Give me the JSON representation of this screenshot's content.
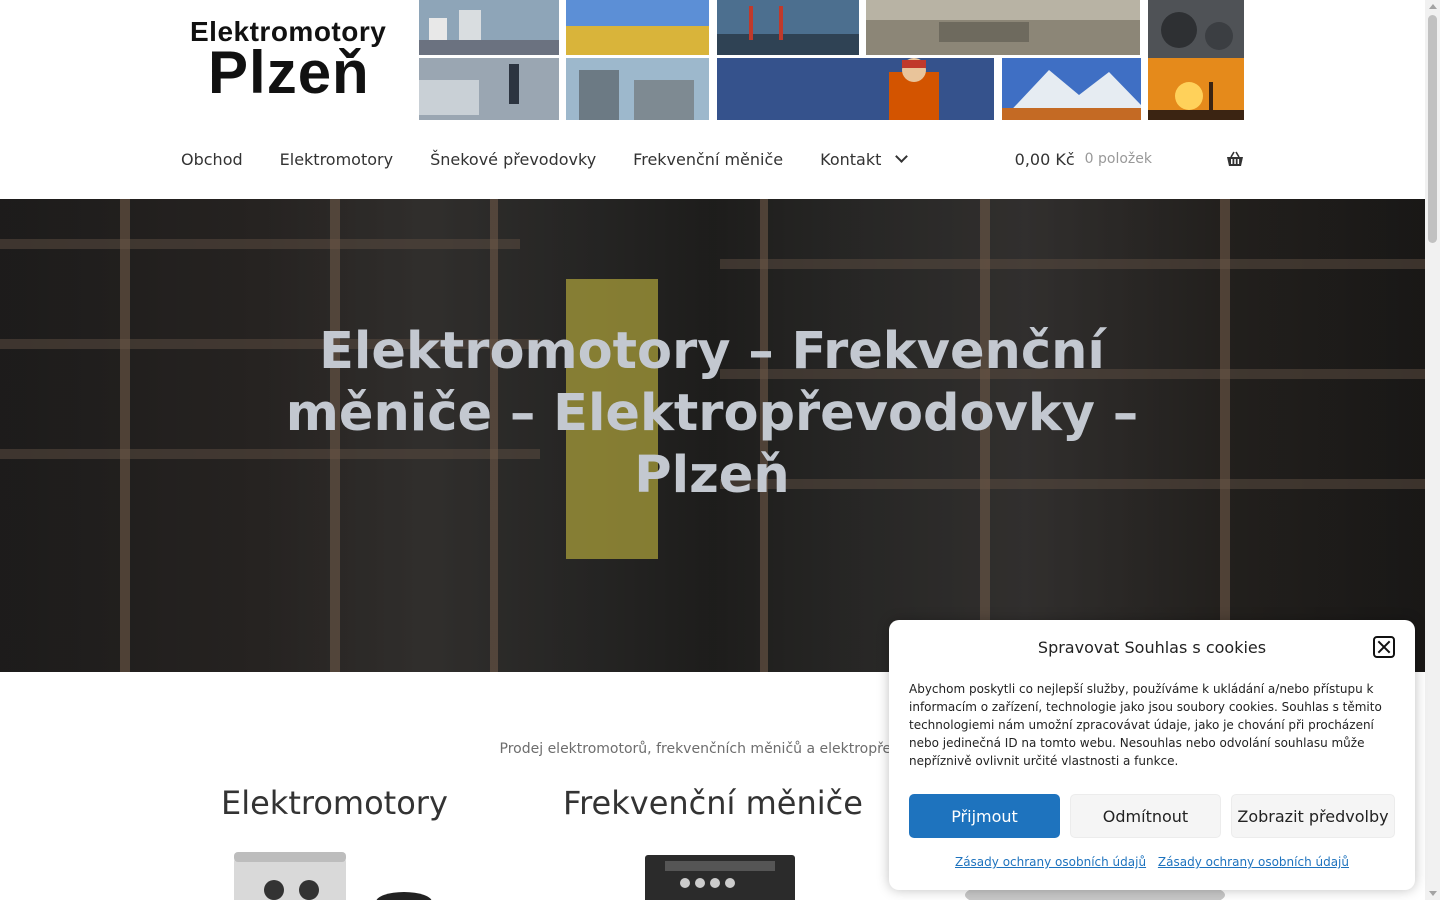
{
  "logo": {
    "line1": "Elektromotory",
    "line2": "Plzeň"
  },
  "nav": {
    "items": [
      "Obchod",
      "Elektromotory",
      "Šnekové převodovky",
      "Frekvenční měniče",
      "Kontakt"
    ]
  },
  "cart": {
    "amount": "0,00 Kč",
    "count": "0 položek",
    "icon": "basket-icon"
  },
  "hero": {
    "title": "Elektromotory – Frekvenční měniče – Elektropřevodovky – Plzeň"
  },
  "content": {
    "tagline": "Prodej elektromotorů, frekvenčních měničů a elektropřevodo",
    "categories": [
      "Elektromotory",
      "Frekvenční měniče"
    ]
  },
  "cookie": {
    "title": "Spravovat Souhlas s cookies",
    "text": "Abychom poskytli co nejlepší služby, používáme k ukládání a/nebo přístupu k informacím o zařízení, technologie jako jsou soubory cookies. Souhlas s těmito technologiemi nám umožní zpracovávat údaje, jako je chování při procházení nebo jedinečná ID na tomto webu. Nesouhlas nebo odvolání souhlasu může nepříznivě ovlivnit určité vlastnosti a funkce.",
    "accept": "Přijmout",
    "deny": "Odmítnout",
    "preferences": "Zobrazit předvolby",
    "link1": "Zásady ochrany osobních údajů",
    "link2": "Zásady ochrany osobních údajů"
  },
  "colors": {
    "accent": "#1e73be",
    "hero_text": "#c3c8d0"
  }
}
